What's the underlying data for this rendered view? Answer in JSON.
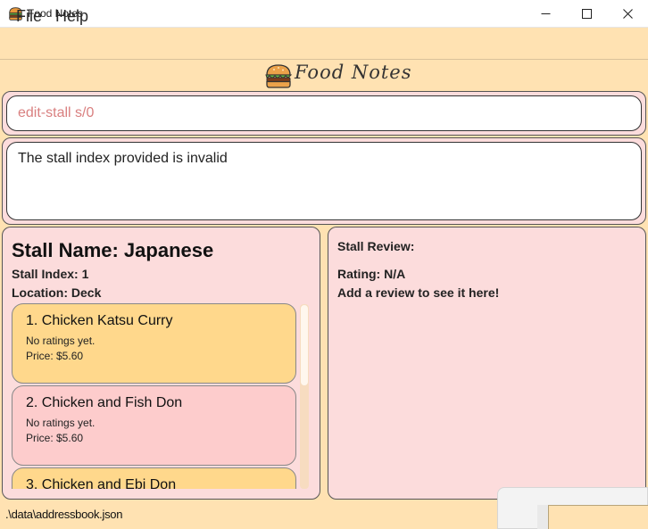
{
  "window": {
    "title": "Food Notes"
  },
  "menu": {
    "items": [
      {
        "label": "File"
      },
      {
        "label": "Help"
      }
    ]
  },
  "logo": {
    "text": "Food Notes"
  },
  "command": {
    "value": "edit-stall s/0"
  },
  "result": {
    "text": "The stall index provided is invalid"
  },
  "stall": {
    "name": "Stall Name: Japanese",
    "index": "Stall Index: 1",
    "location": "Location: Deck",
    "menu_items": [
      {
        "name": "1.  Chicken Katsu Curry",
        "rating": "No ratings yet.",
        "price": "Price: $5.60",
        "color": "#ffd88c"
      },
      {
        "name": "2.  Chicken and Fish Don",
        "rating": "No ratings yet.",
        "price": "Price: $5.60",
        "color": "#fdcccc"
      },
      {
        "name": "3.  Chicken and Ebi Don",
        "rating": "",
        "price": "",
        "color": "#ffd88c"
      }
    ]
  },
  "review": {
    "title": "Stall Review:",
    "rating": "Rating: N/A",
    "empty_text": "Add a review to see it here!"
  },
  "status": {
    "path": ".\\data\\addressbook.json"
  },
  "colors": {
    "background": "#ffe2b2",
    "panel": "#fcdcdc",
    "card_odd": "#ffd88c",
    "card_even": "#fdcccc"
  }
}
